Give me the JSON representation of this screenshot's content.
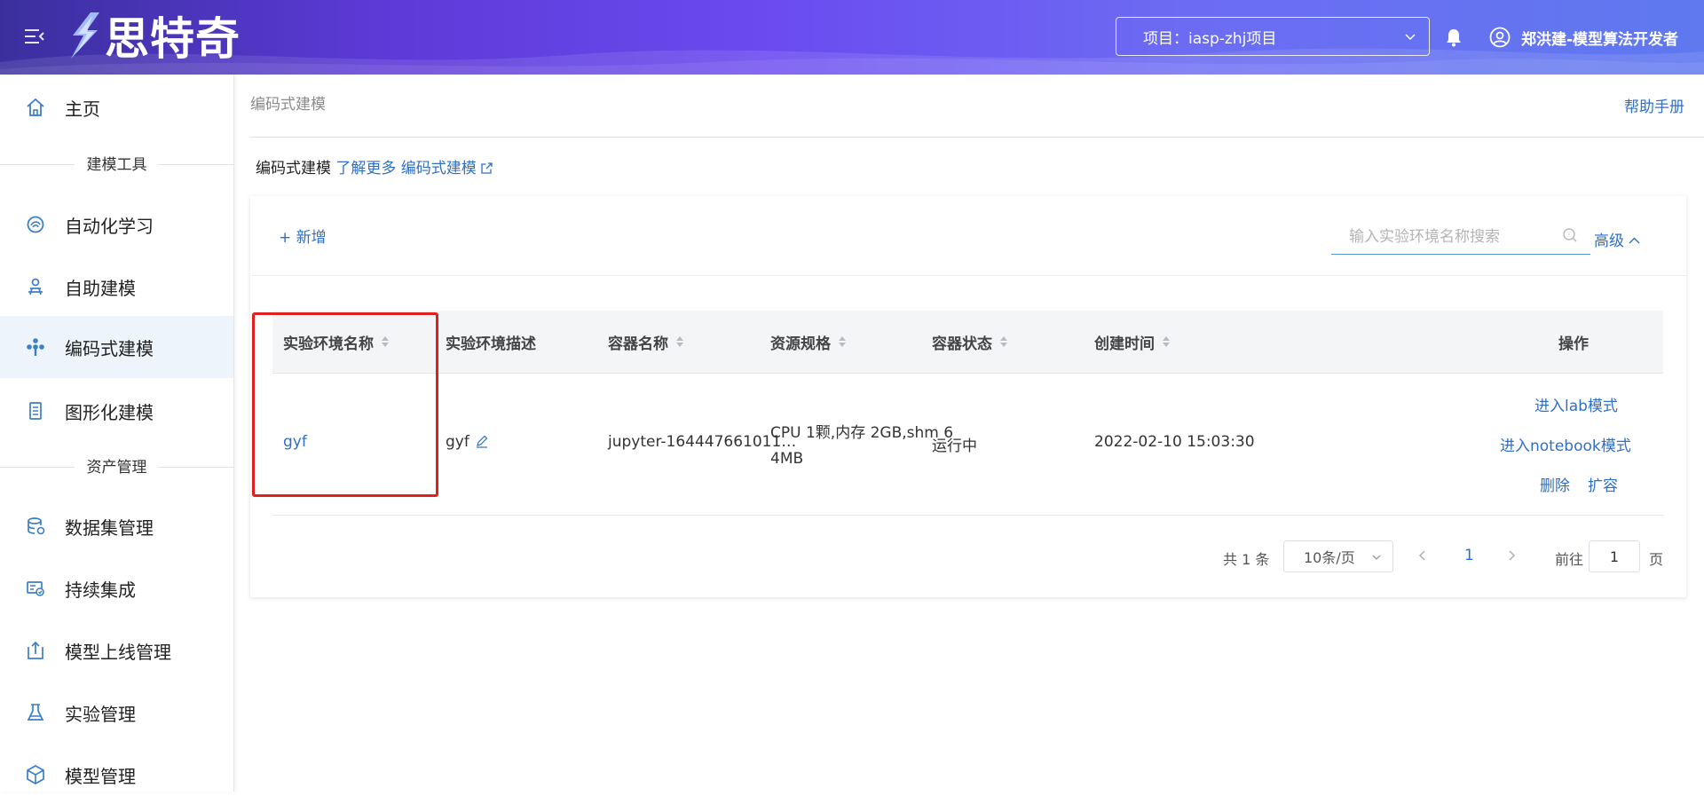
{
  "header": {
    "logo_text": "思特奇",
    "project_select": "项目：iasp-zhj项目",
    "user_name": "郑洪建-模型算法开发者"
  },
  "sidebar": {
    "items": [
      {
        "label": "主页",
        "icon": "home-icon"
      },
      {
        "label": "自动化学习",
        "icon": "auto-learning-icon"
      },
      {
        "label": "自助建模",
        "icon": "self-modeling-icon"
      },
      {
        "label": "编码式建模",
        "icon": "code-modeling-icon",
        "active": true
      },
      {
        "label": "图形化建模",
        "icon": "graphical-modeling-icon"
      },
      {
        "label": "数据集管理",
        "icon": "database-icon"
      },
      {
        "label": "持续集成",
        "icon": "continuous-integration-icon"
      },
      {
        "label": "模型上线管理",
        "icon": "upload-icon"
      },
      {
        "label": "实验管理",
        "icon": "flask-icon"
      },
      {
        "label": "模型管理",
        "icon": "cube-icon"
      }
    ],
    "groups": [
      "建模工具",
      "资产管理"
    ]
  },
  "main": {
    "breadcrumb": "编码式建模",
    "help_link": "帮助手册",
    "intro_text": "编码式建模",
    "intro_link": "了解更多 编码式建模",
    "add_button": "+ 新增",
    "search_placeholder": "输入实验环境名称搜索",
    "advanced_label": "高级",
    "table": {
      "columns": [
        "实验环境名称",
        "实验环境描述",
        "容器名称",
        "资源规格",
        "容器状态",
        "创建时间",
        "操作"
      ],
      "rows": [
        {
          "name": "gyf",
          "description": "gyf",
          "container": "jupyter-164447661011…",
          "resource_line1": "CPU 1颗,内存 2GB,shm 6",
          "resource_line2": "4MB",
          "status": "运行中",
          "created": "2022-02-10 15:03:30",
          "actions": [
            "进入lab模式",
            "进入notebook模式",
            "删除",
            "扩容"
          ]
        }
      ]
    },
    "pagination": {
      "total": "共 1 条",
      "page_size": "10条/页",
      "current_page": "1",
      "goto_label": "前往",
      "goto_value": "1",
      "goto_suffix": "页"
    }
  },
  "colors": {
    "accent": "#2f6fc6",
    "header_gradient_start": "#3b2f9e",
    "header_gradient_end": "#5f79ef",
    "highlight": "#e02020"
  }
}
